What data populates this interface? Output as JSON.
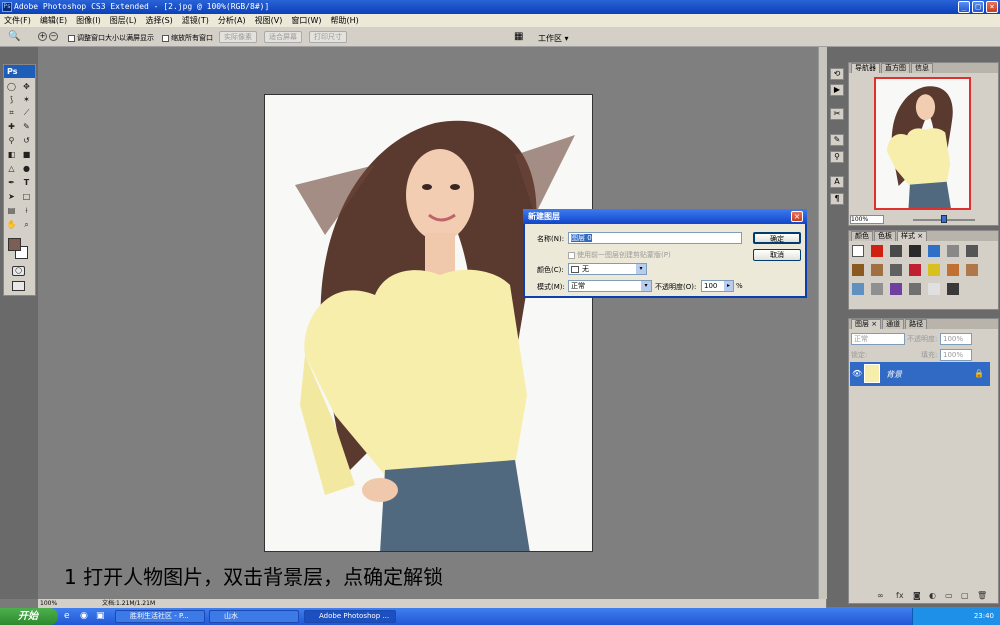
{
  "window": {
    "title": "Adobe Photoshop CS3 Extended - [2.jpg @ 100%(RGB/8#)]",
    "min": "_",
    "max": "□",
    "close": "×"
  },
  "menu": [
    "文件(F)",
    "编辑(E)",
    "图像(I)",
    "图层(L)",
    "选择(S)",
    "滤镜(T)",
    "分析(A)",
    "视图(V)",
    "窗口(W)",
    "帮助(H)"
  ],
  "options": {
    "resize_windows": "调整窗口大小以满屏显示",
    "zoom_all": "缩放所有窗口",
    "actual_pixels": "实际像素",
    "fit_screen": "适合屏幕",
    "print_size": "打印尺寸",
    "workspace": "工作区 ▾"
  },
  "toolbox": {
    "logo": "Ps"
  },
  "caption": "1  打开人物图片，双击背景层，点确定解锁",
  "status": {
    "zoom": "100%",
    "doc": "文档:1.21M/1.21M"
  },
  "dialog": {
    "title": "新建图层",
    "name_label": "名称(N):",
    "name_value": "图层 0",
    "clip_label": "使用前一图层创建剪贴蒙版(P)",
    "color_label": "颜色(C):",
    "color_value": "无",
    "mode_label": "模式(M):",
    "mode_value": "正常",
    "opacity_label": "不透明度(O):",
    "opacity_value": "100",
    "opacity_unit": "%",
    "ok": "确定",
    "cancel": "取消"
  },
  "navigator": {
    "tabs": [
      "导航器",
      "直方图",
      "信息"
    ],
    "zoom": "100%"
  },
  "swatches": {
    "tabs": [
      "颜色",
      "色板",
      "样式 ×"
    ]
  },
  "layers": {
    "tabs": [
      "图层 ×",
      "通道",
      "路径"
    ],
    "blend": "正常",
    "opacity_label": "不透明度:",
    "opacity_value": "100%",
    "lock_label": "锁定:",
    "fill_label": "填充:",
    "fill_value": "100%",
    "layer_name": "背景"
  },
  "taskbar": {
    "start": "开始",
    "tasks": [
      "胜利生活社区 - P...",
      "山水",
      "Adobe Photoshop ..."
    ],
    "clock": "23:40"
  },
  "colors": {
    "foreground": "#7b5f55",
    "background": "#ffffff",
    "accent": "#1f5eb8"
  }
}
